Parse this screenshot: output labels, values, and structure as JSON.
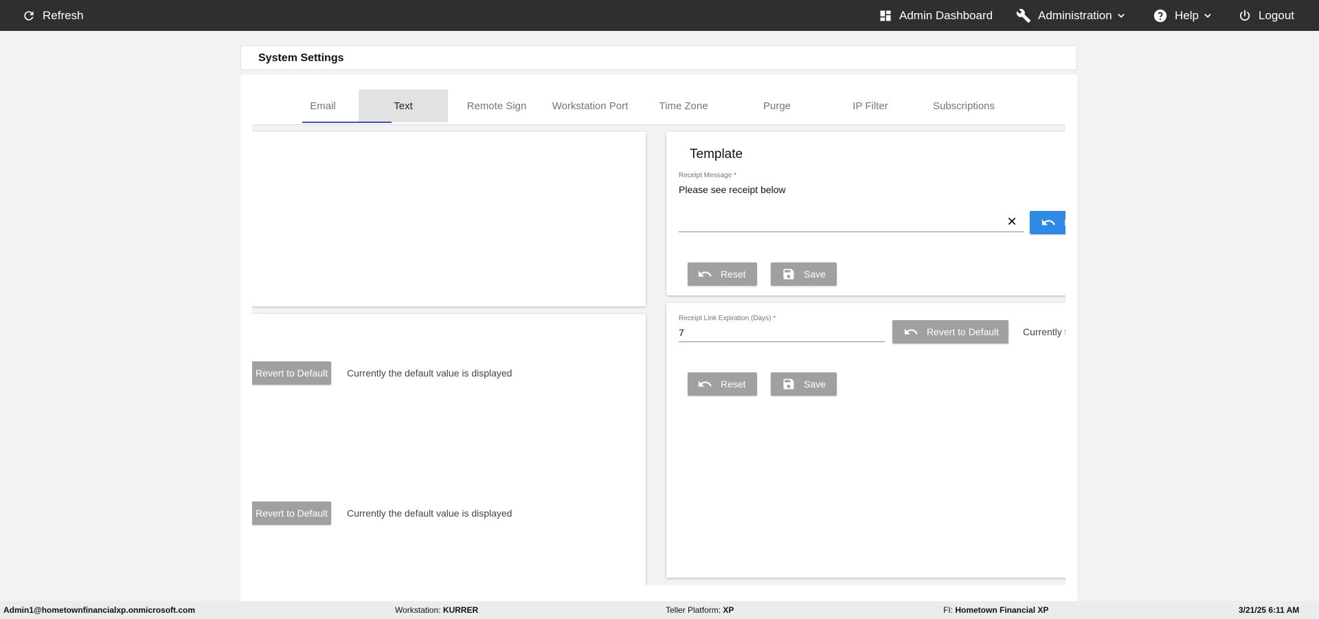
{
  "topbar": {
    "refresh_label": "Refresh",
    "admin_dashboard_label": "Admin Dashboard",
    "administration_label": "Administration",
    "help_label": "Help",
    "logout_label": "Logout"
  },
  "page": {
    "title": "System Settings"
  },
  "tabs": [
    {
      "label": "Email"
    },
    {
      "label": "Text"
    },
    {
      "label": "Remote Sign"
    },
    {
      "label": "Workstation Port"
    },
    {
      "label": "Time Zone"
    },
    {
      "label": "Purge"
    },
    {
      "label": "IP Filter"
    },
    {
      "label": "Subscriptions"
    }
  ],
  "active_tab": "Text",
  "left": {
    "revert_label_1": "Revert to Default",
    "status_1": "Currently the default value is displayed",
    "revert_label_2": "Revert to Default",
    "status_2": "Currently the default value is displayed"
  },
  "template": {
    "heading": "Template",
    "field_label": "Receipt Message *",
    "field_value": "Please see receipt below",
    "revert_button_partial": "R",
    "reset_label": "Reset",
    "save_label": "Save"
  },
  "expiration": {
    "field_label": "Receipt Link Expiration (Days) *",
    "field_value": "7",
    "revert_label": "Revert to Default",
    "status_partial": "Currently t",
    "reset_label": "Reset",
    "save_label": "Save"
  },
  "footer": {
    "user": "Admin1@hometownfinancialxp.onmicrosoft.com",
    "workstation_label": "Workstation:",
    "workstation_value": "KURRER",
    "teller_label": "Teller Platform:",
    "teller_value": "XP",
    "fi_label": "FI:",
    "fi_value": "Hometown Financial XP",
    "datetime": "3/21/25 6:11 AM"
  },
  "colors": {
    "topbar_bg": "#2f2f2f",
    "accent_blue": "#2e8ae6",
    "tab_indicator": "#3f51b5",
    "button_gray": "#a0a0a0"
  },
  "icons": {
    "refresh": "refresh-icon",
    "dashboard": "dashboard-icon",
    "wrench": "wrench-icon",
    "help": "help-icon",
    "power": "power-icon",
    "undo": "undo-icon",
    "save": "save-icon",
    "close": "close-icon"
  }
}
